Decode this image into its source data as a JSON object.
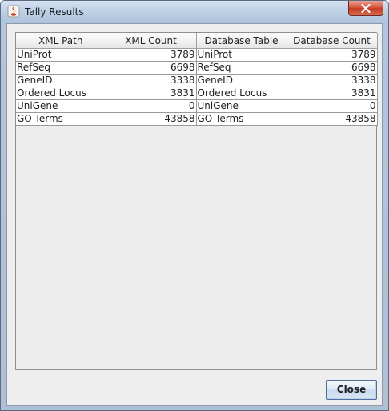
{
  "window": {
    "title": "Tally Results",
    "icon": "java-icon",
    "close_icon": "close-icon"
  },
  "table": {
    "columns": [
      "XML Path",
      "XML Count",
      "Database Table",
      "Database Count"
    ],
    "rows": [
      [
        "UniProt",
        "3789",
        "UniProt",
        "3789"
      ],
      [
        "RefSeq",
        "6698",
        "RefSeq",
        "6698"
      ],
      [
        "GeneID",
        "3338",
        "GeneID",
        "3338"
      ],
      [
        "Ordered Locus",
        "3831",
        "Ordered Locus",
        "3831"
      ],
      [
        "UniGene",
        "0",
        "UniGene",
        "0"
      ],
      [
        "GO Terms",
        "43858",
        "GO Terms",
        "43858"
      ]
    ]
  },
  "buttons": {
    "close_label": "Close"
  }
}
